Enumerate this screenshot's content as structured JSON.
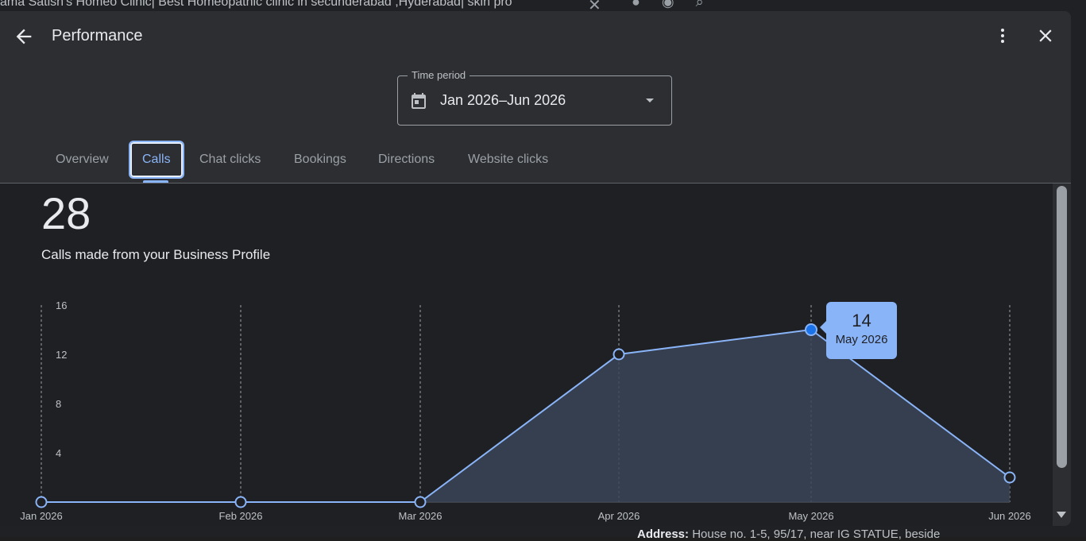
{
  "background": {
    "page_title": "ama Satish's Homeo Clinic| Best Homeopathic clinic in secunderabad ,Hyderabad| skin pro",
    "bottom_label": "Address:",
    "bottom_value": "House no. 1-5, 95/17, near IG STATUE, beside"
  },
  "dialog": {
    "title": "Performance",
    "time_period": {
      "label": "Time period",
      "value": "Jan 2026–Jun 2026"
    },
    "tabs": [
      {
        "label": "Overview",
        "active": false
      },
      {
        "label": "Calls",
        "active": true
      },
      {
        "label": "Chat clicks",
        "active": false
      },
      {
        "label": "Bookings",
        "active": false
      },
      {
        "label": "Directions",
        "active": false
      },
      {
        "label": "Website clicks",
        "active": false
      }
    ],
    "total": "28",
    "subtitle": "Calls made from your Business Profile",
    "tooltip": {
      "value": "14",
      "label": "May 2026"
    }
  },
  "colors": {
    "accent": "#8ab4f8",
    "point_active": "#1a73e8",
    "area_fill": "#3b4558"
  },
  "chart_data": {
    "type": "area",
    "categories": [
      "Jan 2026",
      "Feb 2026",
      "Mar 2026",
      "Apr 2026",
      "May 2026",
      "Jun 2026"
    ],
    "values": [
      0,
      0,
      0,
      12,
      14,
      2
    ],
    "y_ticks": [
      "4",
      "8",
      "12",
      "16"
    ],
    "ylim": [
      0,
      16
    ],
    "highlighted": "May 2026",
    "grid": "vertical dashed"
  }
}
